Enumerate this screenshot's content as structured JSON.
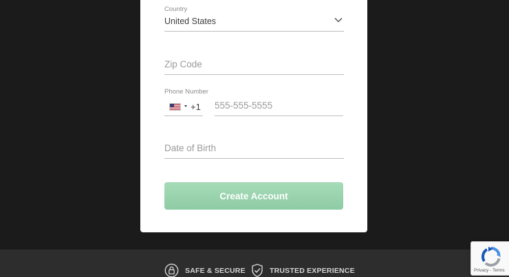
{
  "form": {
    "country": {
      "label": "Country",
      "value": "United States"
    },
    "zip": {
      "placeholder": "Zip Code"
    },
    "phone": {
      "label": "Phone Number",
      "dial_code": "+1",
      "flag_icon": "us-flag-icon",
      "placeholder": "555-555-5555"
    },
    "dob": {
      "placeholder": "Date of Birth"
    },
    "submit_label": "Create Account"
  },
  "footer": {
    "badges": [
      {
        "icon": "lock-icon",
        "label": "SAFE & SECURE"
      },
      {
        "icon": "shield-check-icon",
        "label": "TRUSTED EXPERIENCE"
      }
    ]
  },
  "recaptcha": {
    "privacy": "Privacy",
    "separator": " - ",
    "terms": "Terms"
  },
  "colors": {
    "background": "#1b1b1b",
    "card": "#ffffff",
    "button": "#9dd5b0",
    "footer": "#2d2d2d"
  }
}
